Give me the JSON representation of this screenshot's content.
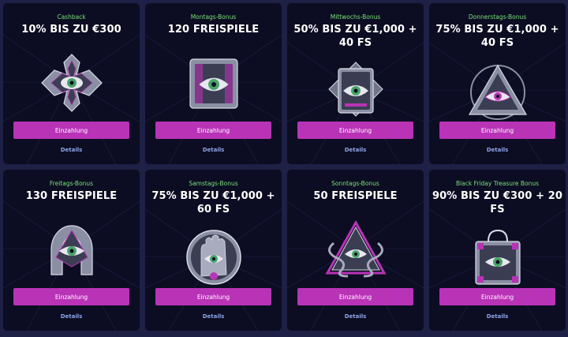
{
  "bonuses": [
    {
      "label": "Cashback",
      "title": "10% BIS ZU €300",
      "button": "Einzahlung",
      "details": "Details",
      "icon": "maltese-cross-eye-icon"
    },
    {
      "label": "Montags-Bonus",
      "title": "120 FREISPIELE",
      "button": "Einzahlung",
      "details": "Details",
      "icon": "slot-machine-eye-icon"
    },
    {
      "label": "Mittwochs-Bonus",
      "title": "50% BIS ZU €1,000 + 40 FS",
      "button": "Einzahlung",
      "details": "Details",
      "icon": "playing-card-eye-icon"
    },
    {
      "label": "Donnerstags-Bonus",
      "title": "75% BIS ZU €1,000 + 40 FS",
      "button": "Einzahlung",
      "details": "Details",
      "icon": "pyramid-eye-icon"
    },
    {
      "label": "Freitags-Bonus",
      "title": "130 FREISPIELE",
      "button": "Einzahlung",
      "details": "Details",
      "icon": "horseshoe-eye-icon"
    },
    {
      "label": "Samstags-Bonus",
      "title": "75% BIS ZU €1,000 + 60 FS",
      "button": "Einzahlung",
      "details": "Details",
      "icon": "hand-coin-eye-icon"
    },
    {
      "label": "Sonntags-Bonus",
      "title": "50 FREISPIELE",
      "button": "Einzahlung",
      "details": "Details",
      "icon": "snake-triangle-eye-icon"
    },
    {
      "label": "Black Friday Treasure Bonus",
      "title": "90% BIS ZU €300 + 20 FS",
      "button": "Einzahlung",
      "details": "Details",
      "icon": "shopping-bag-eye-icon"
    }
  ],
  "colors": {
    "page_background": "#1e2046",
    "card_background": "#0c0d22",
    "label_green": "#79e07a",
    "button_magenta": "#b933b6",
    "details_blue": "#8da2e6"
  }
}
